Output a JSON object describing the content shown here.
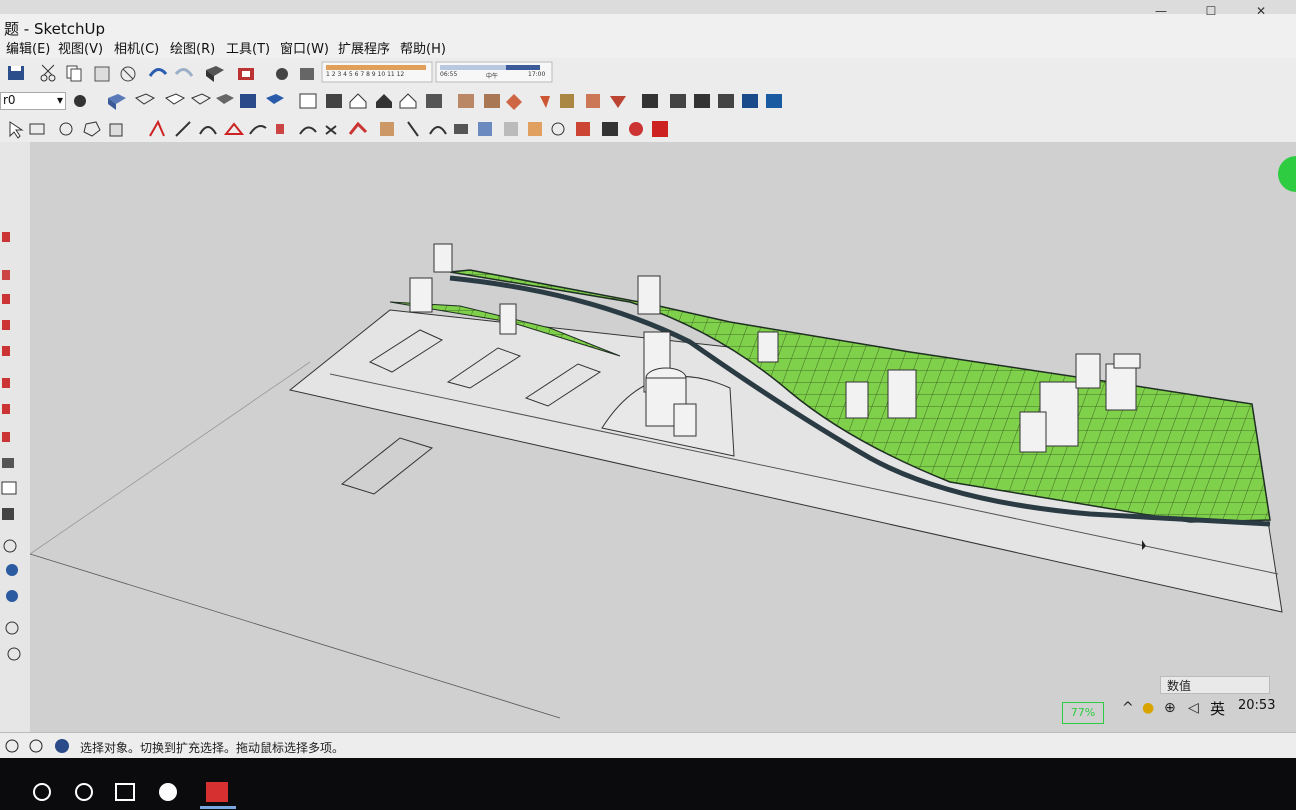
{
  "window": {
    "title": "题 - SketchUp"
  },
  "menu": {
    "items": [
      "编辑(E)",
      "视图(V)",
      "相机(C)",
      "绘图(R)",
      "工具(T)",
      "窗口(W)",
      "扩展程序",
      "帮助(H)"
    ]
  },
  "toolbar": {
    "shadow_scale_left": "1 2 3 4 5 6 7 8 9 10 11 12",
    "shadow_time_left": "06:55",
    "shadow_time_mid": "中午",
    "shadow_time_right": "17:00",
    "layer_value": "r0"
  },
  "viewport": {
    "value_label": "数值"
  },
  "statusbar": {
    "message": "选择对象。切换到扩充选择。拖动鼠标选择多项。"
  },
  "tray": {
    "battery": "77%",
    "ime": "英",
    "clock": "20:53"
  },
  "colors": {
    "terrain": "#7fd04a",
    "terrain_dark": "#5bb02a",
    "road": "#2b3b44",
    "ground": "#dedede"
  },
  "icons": [
    "save-icon",
    "cut-icon",
    "copy-icon",
    "paste-icon",
    "erase-icon",
    "undo-icon",
    "redo-icon",
    "component-icon",
    "battery-icon",
    "ime-icon"
  ]
}
